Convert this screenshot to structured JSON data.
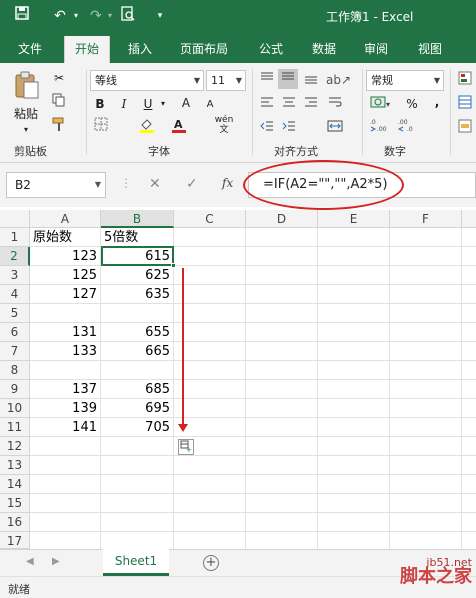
{
  "title": "工作簿1 - Excel",
  "tabs": [
    {
      "label": "文件"
    },
    {
      "label": "开始"
    },
    {
      "label": "插入"
    },
    {
      "label": "页面布局"
    },
    {
      "label": "公式"
    },
    {
      "label": "数据"
    },
    {
      "label": "审阅"
    },
    {
      "label": "视图"
    }
  ],
  "ribbon": {
    "paste_label": "粘贴",
    "clipboard_group": "剪贴板",
    "font_name": "等线",
    "font_size": "11",
    "font_group": "字体",
    "bold": "B",
    "italic": "I",
    "underline": "U",
    "increase_font": "A",
    "decrease_font": "A",
    "wen_label": "wén",
    "align_group": "对齐方式",
    "number_format": "常规",
    "number_group": "数字",
    "percent": "%",
    "comma": ","
  },
  "formula_bar": {
    "name_box": "B2",
    "fx": "fx",
    "formula": "=IF(A2=\"\",\"\",A2*5)"
  },
  "columns": [
    "A",
    "B",
    "C",
    "D",
    "E",
    "F"
  ],
  "rows": [
    "1",
    "2",
    "3",
    "4",
    "5",
    "6",
    "7",
    "8",
    "9",
    "10",
    "11",
    "12",
    "13",
    "14",
    "15",
    "16",
    "17"
  ],
  "cells": {
    "a1": "原始数",
    "b1": "5倍数",
    "a2": "123",
    "b2": "615",
    "a3": "125",
    "b3": "625",
    "a4": "127",
    "b4": "635",
    "a6": "131",
    "b6": "655",
    "a7": "133",
    "b7": "665",
    "a9": "137",
    "b9": "685",
    "a10": "139",
    "b10": "695",
    "a11": "141",
    "b11": "705"
  },
  "sheet_tab": "Sheet1",
  "add_sheet": "+",
  "status": "就绪",
  "watermark": {
    "line1": "jb51.net",
    "line2": "脚本之家"
  },
  "colors": {
    "accent": "#217346",
    "annotation": "#d42323"
  }
}
